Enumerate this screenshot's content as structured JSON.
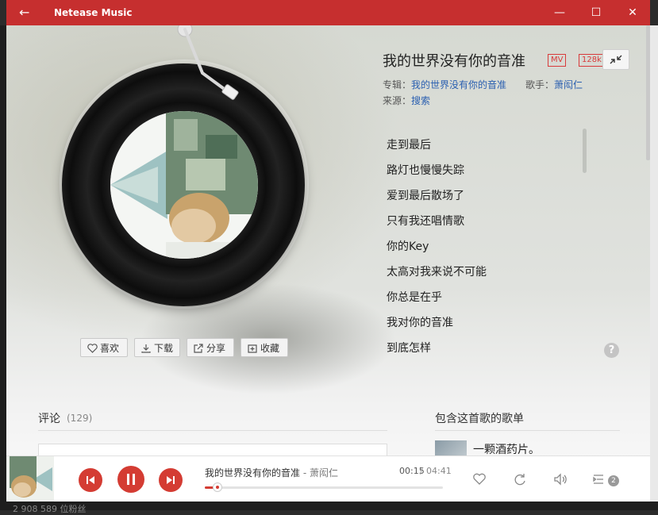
{
  "window": {
    "title": "Netease Music",
    "back_glyph": "←",
    "minimize_glyph": "—",
    "maximize_glyph": "☐",
    "close_glyph": "✕"
  },
  "song": {
    "title": "我的世界没有你的音准",
    "mv_tag": "MV",
    "quality_tag": "128k",
    "album_label": "专辑：",
    "album": "我的世界没有你的音准",
    "artist_label": "歌手：",
    "artist": "萧闳仁",
    "source_label": "来源：",
    "source": "搜索"
  },
  "actions": {
    "like": "喜欢",
    "download": "下载",
    "share": "分享",
    "collect": "收藏"
  },
  "lyrics": [
    "走到最后",
    "路灯也慢慢失踪",
    "爱到最后散场了",
    "只有我还唱情歌",
    "你的Key",
    "太高对我来说不可能",
    "你总是在乎",
    "我对你的音准",
    "到底怎样"
  ],
  "help_glyph": "?",
  "comments": {
    "title": "评论",
    "count": "(129)"
  },
  "playlists": {
    "title": "包含这首歌的歌单",
    "items": [
      {
        "name": "一颗酒药片。"
      }
    ]
  },
  "player": {
    "song": "我的世界没有你的音准",
    "separator": " - ",
    "artist": "萧闳仁",
    "current_time": "00:15",
    "time_separator": "/",
    "total_time": "04:41",
    "progress_fraction": 0.053,
    "queue_count": "2",
    "accent_color": "#d43c33"
  },
  "background": {
    "bottom_text": "2 908 589 位粉丝"
  }
}
